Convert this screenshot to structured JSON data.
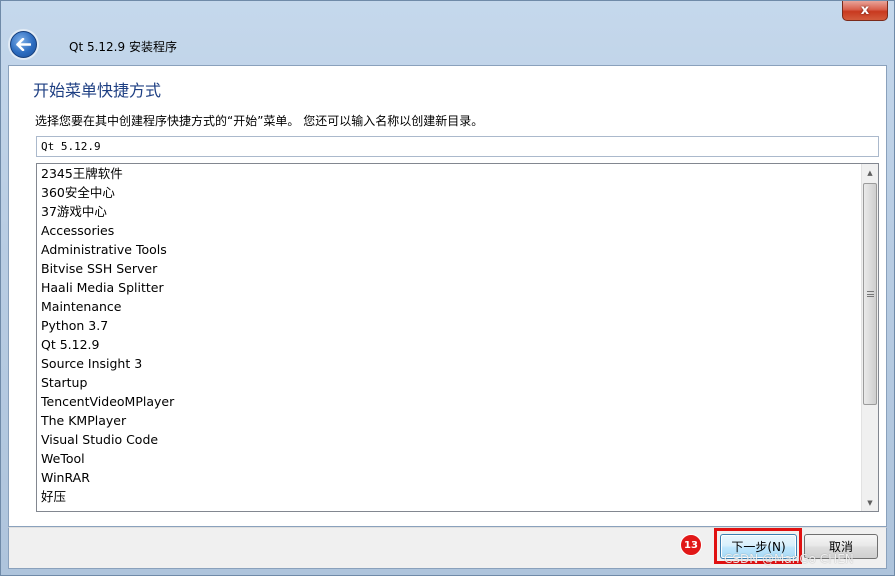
{
  "window": {
    "title": "Qt 5.12.9 安装程序",
    "close_label": "x"
  },
  "page": {
    "heading": "开始菜单快捷方式",
    "instruction": "选择您要在其中创建程序快捷方式的“开始”菜单。 您还可以输入名称以创建新目录。"
  },
  "folder_input": {
    "value": "Qt 5.12.9"
  },
  "folder_list": {
    "items": [
      "2345王牌软件",
      "360安全中心",
      "37游戏中心",
      "Accessories",
      "Administrative Tools",
      "Bitvise SSH Server",
      "Haali Media Splitter",
      "Maintenance",
      "Python 3.7",
      "Qt 5.12.9",
      "Source Insight 3",
      "Startup",
      "TencentVideoMPlayer",
      "The KMPlayer",
      "Visual Studio Code",
      "WeTool",
      "WinRAR",
      "好压"
    ]
  },
  "buttons": {
    "next_label": "下一步(N)",
    "cancel_label": "取消"
  },
  "annotation": {
    "step_number": "13",
    "highlight_color": "#e01010"
  },
  "watermark": "CSDN @ManGo CHEN",
  "colors": {
    "heading": "#1e3f83",
    "close_button": "#c8391f",
    "back_button": "#2c6cc0"
  }
}
